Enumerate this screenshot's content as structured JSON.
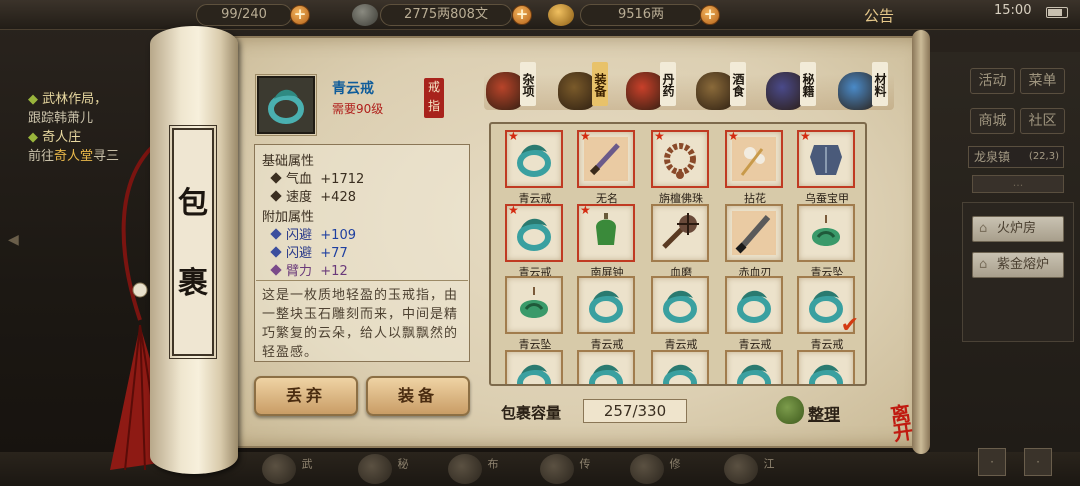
{
  "topbar": {
    "stamina": "99/240",
    "copper": "2775两808文",
    "silver": "9516两",
    "notice": "公告",
    "clock": "15:00"
  },
  "quests": [
    {
      "title": "武林作局，",
      "line": "跟踪韩萧儿",
      "hl": ""
    },
    {
      "title": "奇人庄",
      "line": "前往",
      "hl": "奇人堂",
      "rest": "寻三"
    }
  ],
  "side": {
    "buttons": [
      "活动",
      "菜单",
      "商城",
      "社区"
    ],
    "location": "龙泉镇",
    "coords": "(22,3)",
    "tab": "...",
    "places": [
      "火炉房",
      "紫金熔炉"
    ]
  },
  "bottom_labels": [
    "武",
    "秘",
    "布",
    "传",
    "修",
    "江",
    "地"
  ],
  "scroll": {
    "label_1": "包",
    "label_2": "裹"
  },
  "selected": {
    "name": "青云戒",
    "requirement": "需要90级",
    "type": "戒指",
    "base_header": "基础属性",
    "base_stats": [
      {
        "name": "气血",
        "value": "+1712"
      },
      {
        "name": "速度",
        "value": "+428"
      }
    ],
    "extra_header": "附加属性",
    "extra_stats": [
      {
        "name": "闪避",
        "value": "+109",
        "tone": "blue"
      },
      {
        "name": "闪避",
        "value": "+77",
        "tone": "blue"
      },
      {
        "name": "臂力",
        "value": "+12",
        "tone": "purple"
      }
    ],
    "description": "这是一枚质地轻盈的玉戒指，由一整块玉石雕刻而来，中间是精巧繁复的云朵，给人以飘飘然的轻盈感。",
    "discard": "丢弃",
    "equip": "装备"
  },
  "categories": [
    {
      "label": "杂项",
      "icon": "jar-icon",
      "color": "#b8442a"
    },
    {
      "label": "装备",
      "icon": "sword-icon",
      "color": "#7a5a2a",
      "active": true
    },
    {
      "label": "丹药",
      "icon": "pill-icon",
      "color": "#c8402a"
    },
    {
      "label": "酒食",
      "icon": "wine-icon",
      "color": "#8a6a3a"
    },
    {
      "label": "秘籍",
      "icon": "book-icon",
      "color": "#4a4a8a"
    },
    {
      "label": "材料",
      "icon": "crystal-icon",
      "color": "#4a8ac8"
    }
  ],
  "items": [
    {
      "name": "青云戒",
      "icon": "jade-ring-icon",
      "color": "#3aa0a0",
      "star": true,
      "red": true
    },
    {
      "name": "无名",
      "icon": "dagger-icon",
      "color": "#8a6a4a",
      "star": true,
      "red": true
    },
    {
      "name": "旃檀佛珠",
      "icon": "prayer-beads-icon",
      "color": "#8a4a2a",
      "star": true,
      "red": true
    },
    {
      "name": "拈花",
      "icon": "flower-icon",
      "color": "#c89a4a",
      "star": true,
      "red": true
    },
    {
      "name": "乌蚕宝甲",
      "icon": "armor-icon",
      "color": "#4a5a7a",
      "star": true,
      "red": true
    },
    {
      "name": "青云戒",
      "icon": "jade-ring-icon",
      "color": "#3aa0a0",
      "star": true,
      "red": true
    },
    {
      "name": "南屏钟",
      "icon": "bell-icon",
      "color": "#3a8a3a",
      "star": true,
      "red": true
    },
    {
      "name": "血磨",
      "icon": "mace-icon",
      "color": "#6a4a3a"
    },
    {
      "name": "赤血刃",
      "icon": "blade-icon",
      "color": "#5a5a5a"
    },
    {
      "name": "青云坠",
      "icon": "jade-pendant-icon",
      "color": "#3a9a6a"
    },
    {
      "name": "青云坠",
      "icon": "jade-pendant-icon",
      "color": "#3a9a6a"
    },
    {
      "name": "青云戒",
      "icon": "jade-ring-icon",
      "color": "#3aa0a0"
    },
    {
      "name": "青云戒",
      "icon": "jade-ring-icon",
      "color": "#3aa0a0"
    },
    {
      "name": "青云戒",
      "icon": "jade-ring-icon",
      "color": "#3aa0a0"
    },
    {
      "name": "青云戒",
      "icon": "jade-ring-icon",
      "color": "#3aa0a0",
      "selected": true
    },
    {
      "name": "",
      "icon": "jade-ring-icon",
      "color": "#3aa0a0"
    },
    {
      "name": "",
      "icon": "jade-ring-icon",
      "color": "#3aa0a0"
    },
    {
      "name": "",
      "icon": "jade-ring-icon",
      "color": "#3aa0a0"
    },
    {
      "name": "",
      "icon": "jade-ring-icon",
      "color": "#3aa0a0"
    },
    {
      "name": "",
      "icon": "jade-ring-icon",
      "color": "#3aa0a0"
    }
  ],
  "capacity": {
    "label": "包裹容量",
    "value": "257/330",
    "sort": "整理"
  },
  "leave": "离开"
}
